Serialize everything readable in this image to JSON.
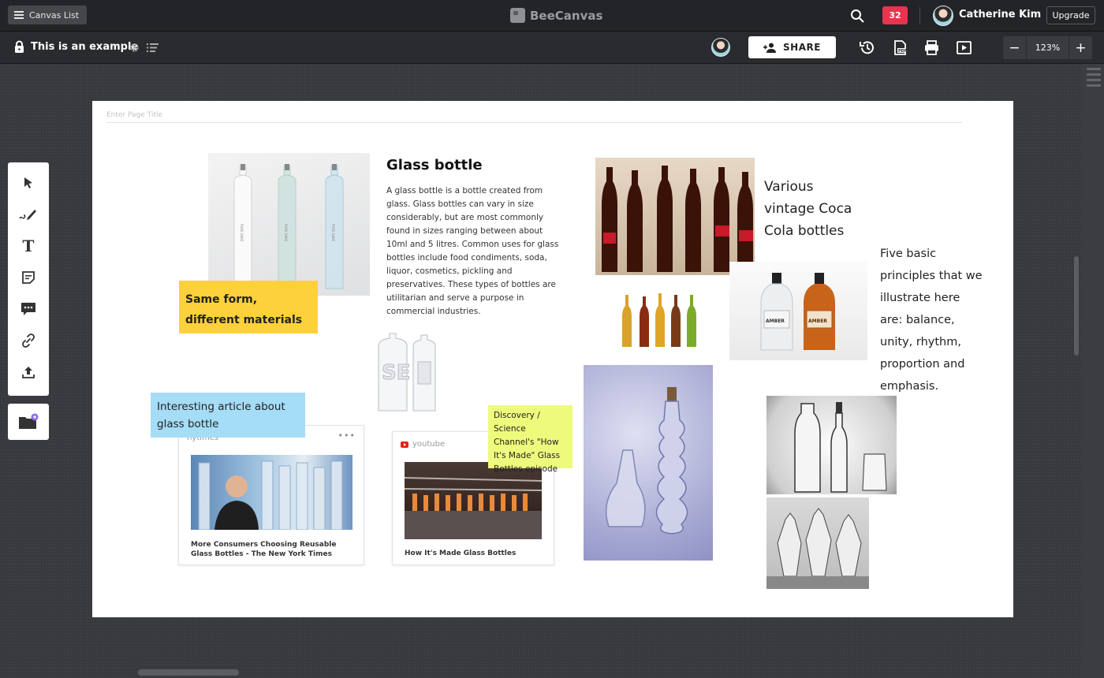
{
  "topbar": {
    "canvas_list_label": "Canvas List",
    "brand_name": "BeeCanvas",
    "notification_count": "32",
    "user_name": "Catherine Kim",
    "upgrade_label": "Upgrade"
  },
  "secondary_bar": {
    "canvas_title": "This is an example",
    "share_label": "SHARE",
    "zoom_level": "123%"
  },
  "page": {
    "title_placeholder": "Enter Page Title"
  },
  "content": {
    "sticky_yellow": "Same form, different materials",
    "heading": "Glass bottle",
    "body": "A glass bottle is a bottle created from glass. Glass bottles can vary in size considerably, but are most commonly found in sizes ranging between about 10ml and 5 litres. Common uses for glass bottles include food condiments, soda, liquor, cosmetics, pickling and preservatives. These types of bottles are utilitarian and serve a purpose in commercial industries.",
    "coca_cola_caption": "Various vintage Coca Cola bottles",
    "principles_text": "Five basic principles that we illustrate here are: balance, unity, rhythm, proportion and emphasis.",
    "sticky_blue": "Interesting article about glass bottle",
    "sticky_lime": "Discovery / Science Channel's \"How It's Made\" Glass Bottles episode",
    "link_nytimes": {
      "source": "nytimes",
      "title": "More Consumers Choosing Reusable Glass Bottles - The New York Times"
    },
    "link_youtube": {
      "source": "youtube",
      "title": "How It's Made Glass Bottles"
    },
    "product_label_amber": "AMBER"
  },
  "colors": {
    "topbar_bg": "#232427",
    "badge_red": "#e8344e",
    "sticky_yellow": "#fcd13b",
    "sticky_blue": "#a5dcf6",
    "sticky_lime": "#eefa7c"
  }
}
